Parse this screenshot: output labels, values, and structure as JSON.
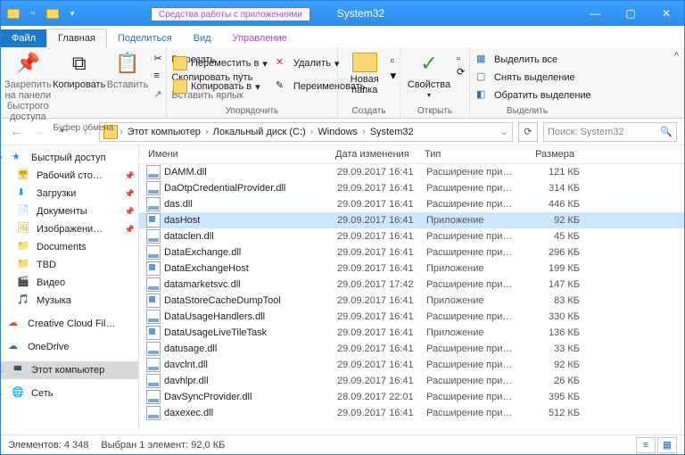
{
  "title_tools": "Средства работы с приложениями",
  "title": "System32",
  "tabs": {
    "file": "Файл",
    "home": "Главная",
    "share": "Поделиться",
    "view": "Вид",
    "manage": "Управление"
  },
  "ribbon": {
    "pin": "Закрепить на панели быстрого доступа",
    "copy": "Копировать",
    "paste": "Вставить",
    "cut": "Вырезать",
    "copypath": "Скопировать путь",
    "pastelnk": "Вставить ярлык",
    "moveto": "Переместить в",
    "copyto": "Копировать в",
    "del": "Удалить",
    "rename": "Переименовать",
    "newfolder": "Новая папка",
    "props": "Свойства",
    "selall": "Выделить все",
    "selnone": "Снять выделение",
    "selinv": "Обратить выделение",
    "g_clip": "Буфер обмена",
    "g_org": "Упорядочить",
    "g_new": "Создать",
    "g_open": "Открыть",
    "g_sel": "Выделить"
  },
  "crumbs": [
    "Этот компьютер",
    "Локальный диск (C:)",
    "Windows",
    "System32"
  ],
  "search_ph": "Поиск: System32",
  "sidebar": [
    {
      "l": "Быстрый доступ",
      "h": 1,
      "ico": "star",
      "exp": "▾"
    },
    {
      "l": "Рабочий сто…",
      "ico": "desk",
      "pin": 1
    },
    {
      "l": "Загрузки",
      "ico": "dl",
      "pin": 1
    },
    {
      "l": "Документы",
      "ico": "doc",
      "pin": 1
    },
    {
      "l": "Изображени…",
      "ico": "pic",
      "pin": 1
    },
    {
      "l": "Documents",
      "ico": "fold"
    },
    {
      "l": "TBD",
      "ico": "fold"
    },
    {
      "l": "Видео",
      "ico": "vid"
    },
    {
      "l": "Музыка",
      "ico": "mus"
    },
    {
      "l": "",
      "h": 1
    },
    {
      "l": "Creative Cloud Fil…",
      "h": 1,
      "ico": "cc"
    },
    {
      "l": "",
      "h": 1
    },
    {
      "l": "OneDrive",
      "h": 1,
      "ico": "od"
    },
    {
      "l": "",
      "h": 1
    },
    {
      "l": "Этот компьютер",
      "h": 1,
      "ico": "pc",
      "sel": 1,
      "exp": "▸"
    },
    {
      "l": "",
      "h": 1
    },
    {
      "l": "Сеть",
      "h": 1,
      "ico": "net",
      "exp": "▸"
    }
  ],
  "columns": {
    "name": "Имени",
    "date": "Дата изменения",
    "type": "Тип",
    "size": "Размера"
  },
  "files": [
    {
      "n": "DAMM.dll",
      "d": "29.09.2017 16:41",
      "t": "Расширение при…",
      "s": "121 КБ",
      "k": "dll"
    },
    {
      "n": "DaOtpCredentialProvider.dll",
      "d": "29.09.2017 16:41",
      "t": "Расширение при…",
      "s": "314 КБ",
      "k": "dll"
    },
    {
      "n": "das.dll",
      "d": "29.09.2017 16:41",
      "t": "Расширение при…",
      "s": "446 КБ",
      "k": "dll"
    },
    {
      "n": "dasHost",
      "d": "29.09.2017 16:41",
      "t": "Приложение",
      "s": "92 КБ",
      "k": "exe",
      "sel": 1
    },
    {
      "n": "dataclen.dll",
      "d": "29.09.2017 16:41",
      "t": "Расширение при…",
      "s": "45 КБ",
      "k": "dll"
    },
    {
      "n": "DataExchange.dll",
      "d": "29.09.2017 16:41",
      "t": "Расширение при…",
      "s": "296 КБ",
      "k": "dll"
    },
    {
      "n": "DataExchangeHost",
      "d": "29.09.2017 16:41",
      "t": "Приложение",
      "s": "199 КБ",
      "k": "exe"
    },
    {
      "n": "datamarketsvc.dll",
      "d": "29.09.2017 17:42",
      "t": "Расширение при…",
      "s": "147 КБ",
      "k": "dll"
    },
    {
      "n": "DataStoreCacheDumpTool",
      "d": "29.09.2017 16:41",
      "t": "Приложение",
      "s": "83 КБ",
      "k": "exe"
    },
    {
      "n": "DataUsageHandlers.dll",
      "d": "29.09.2017 16:41",
      "t": "Расширение при…",
      "s": "330 КБ",
      "k": "dll"
    },
    {
      "n": "DataUsageLiveTileTask",
      "d": "29.09.2017 16:41",
      "t": "Приложение",
      "s": "136 КБ",
      "k": "exe"
    },
    {
      "n": "datusage.dll",
      "d": "29.09.2017 16:41",
      "t": "Расширение при…",
      "s": "33 КБ",
      "k": "dll"
    },
    {
      "n": "davclnt.dll",
      "d": "29.09.2017 16:41",
      "t": "Расширение при…",
      "s": "92 КБ",
      "k": "dll"
    },
    {
      "n": "davhlpr.dll",
      "d": "29.09.2017 16:41",
      "t": "Расширение при…",
      "s": "26 КБ",
      "k": "dll"
    },
    {
      "n": "DavSyncProvider.dll",
      "d": "28.09.2017 22:01",
      "t": "Расширение при…",
      "s": "395 КБ",
      "k": "dll"
    },
    {
      "n": "daxexec.dll",
      "d": "29.09.2017 16:41",
      "t": "Расширение при…",
      "s": "512 КБ",
      "k": "dll"
    }
  ],
  "status": {
    "count": "Элементов: 4 348",
    "sel": "Выбран 1 элемент: 92,0 КБ"
  }
}
